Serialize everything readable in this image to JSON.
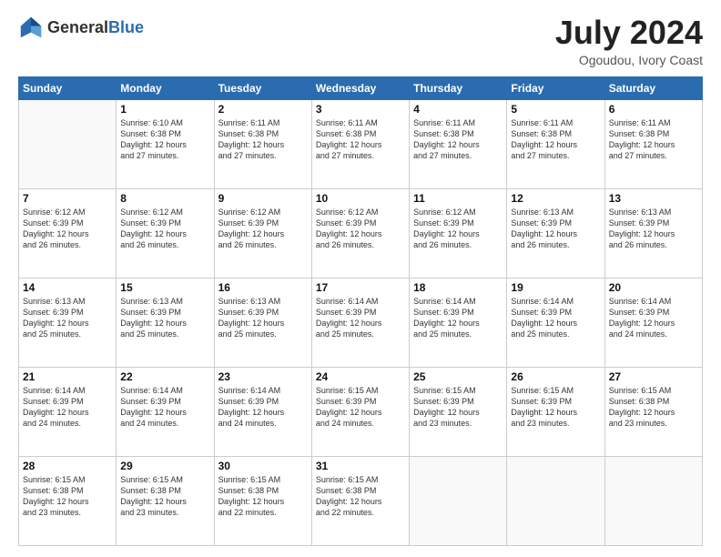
{
  "header": {
    "logo_general": "General",
    "logo_blue": "Blue",
    "month_title": "July 2024",
    "location": "Ogoudou, Ivory Coast"
  },
  "calendar": {
    "days_of_week": [
      "Sunday",
      "Monday",
      "Tuesday",
      "Wednesday",
      "Thursday",
      "Friday",
      "Saturday"
    ],
    "weeks": [
      [
        {
          "day": "",
          "info": ""
        },
        {
          "day": "1",
          "info": "Sunrise: 6:10 AM\nSunset: 6:38 PM\nDaylight: 12 hours\nand 27 minutes."
        },
        {
          "day": "2",
          "info": "Sunrise: 6:11 AM\nSunset: 6:38 PM\nDaylight: 12 hours\nand 27 minutes."
        },
        {
          "day": "3",
          "info": "Sunrise: 6:11 AM\nSunset: 6:38 PM\nDaylight: 12 hours\nand 27 minutes."
        },
        {
          "day": "4",
          "info": "Sunrise: 6:11 AM\nSunset: 6:38 PM\nDaylight: 12 hours\nand 27 minutes."
        },
        {
          "day": "5",
          "info": "Sunrise: 6:11 AM\nSunset: 6:38 PM\nDaylight: 12 hours\nand 27 minutes."
        },
        {
          "day": "6",
          "info": "Sunrise: 6:11 AM\nSunset: 6:38 PM\nDaylight: 12 hours\nand 27 minutes."
        }
      ],
      [
        {
          "day": "7",
          "info": "Sunrise: 6:12 AM\nSunset: 6:39 PM\nDaylight: 12 hours\nand 26 minutes."
        },
        {
          "day": "8",
          "info": "Sunrise: 6:12 AM\nSunset: 6:39 PM\nDaylight: 12 hours\nand 26 minutes."
        },
        {
          "day": "9",
          "info": "Sunrise: 6:12 AM\nSunset: 6:39 PM\nDaylight: 12 hours\nand 26 minutes."
        },
        {
          "day": "10",
          "info": "Sunrise: 6:12 AM\nSunset: 6:39 PM\nDaylight: 12 hours\nand 26 minutes."
        },
        {
          "day": "11",
          "info": "Sunrise: 6:12 AM\nSunset: 6:39 PM\nDaylight: 12 hours\nand 26 minutes."
        },
        {
          "day": "12",
          "info": "Sunrise: 6:13 AM\nSunset: 6:39 PM\nDaylight: 12 hours\nand 26 minutes."
        },
        {
          "day": "13",
          "info": "Sunrise: 6:13 AM\nSunset: 6:39 PM\nDaylight: 12 hours\nand 26 minutes."
        }
      ],
      [
        {
          "day": "14",
          "info": "Sunrise: 6:13 AM\nSunset: 6:39 PM\nDaylight: 12 hours\nand 25 minutes."
        },
        {
          "day": "15",
          "info": "Sunrise: 6:13 AM\nSunset: 6:39 PM\nDaylight: 12 hours\nand 25 minutes."
        },
        {
          "day": "16",
          "info": "Sunrise: 6:13 AM\nSunset: 6:39 PM\nDaylight: 12 hours\nand 25 minutes."
        },
        {
          "day": "17",
          "info": "Sunrise: 6:14 AM\nSunset: 6:39 PM\nDaylight: 12 hours\nand 25 minutes."
        },
        {
          "day": "18",
          "info": "Sunrise: 6:14 AM\nSunset: 6:39 PM\nDaylight: 12 hours\nand 25 minutes."
        },
        {
          "day": "19",
          "info": "Sunrise: 6:14 AM\nSunset: 6:39 PM\nDaylight: 12 hours\nand 25 minutes."
        },
        {
          "day": "20",
          "info": "Sunrise: 6:14 AM\nSunset: 6:39 PM\nDaylight: 12 hours\nand 24 minutes."
        }
      ],
      [
        {
          "day": "21",
          "info": "Sunrise: 6:14 AM\nSunset: 6:39 PM\nDaylight: 12 hours\nand 24 minutes."
        },
        {
          "day": "22",
          "info": "Sunrise: 6:14 AM\nSunset: 6:39 PM\nDaylight: 12 hours\nand 24 minutes."
        },
        {
          "day": "23",
          "info": "Sunrise: 6:14 AM\nSunset: 6:39 PM\nDaylight: 12 hours\nand 24 minutes."
        },
        {
          "day": "24",
          "info": "Sunrise: 6:15 AM\nSunset: 6:39 PM\nDaylight: 12 hours\nand 24 minutes."
        },
        {
          "day": "25",
          "info": "Sunrise: 6:15 AM\nSunset: 6:39 PM\nDaylight: 12 hours\nand 23 minutes."
        },
        {
          "day": "26",
          "info": "Sunrise: 6:15 AM\nSunset: 6:39 PM\nDaylight: 12 hours\nand 23 minutes."
        },
        {
          "day": "27",
          "info": "Sunrise: 6:15 AM\nSunset: 6:38 PM\nDaylight: 12 hours\nand 23 minutes."
        }
      ],
      [
        {
          "day": "28",
          "info": "Sunrise: 6:15 AM\nSunset: 6:38 PM\nDaylight: 12 hours\nand 23 minutes."
        },
        {
          "day": "29",
          "info": "Sunrise: 6:15 AM\nSunset: 6:38 PM\nDaylight: 12 hours\nand 23 minutes."
        },
        {
          "day": "30",
          "info": "Sunrise: 6:15 AM\nSunset: 6:38 PM\nDaylight: 12 hours\nand 22 minutes."
        },
        {
          "day": "31",
          "info": "Sunrise: 6:15 AM\nSunset: 6:38 PM\nDaylight: 12 hours\nand 22 minutes."
        },
        {
          "day": "",
          "info": ""
        },
        {
          "day": "",
          "info": ""
        },
        {
          "day": "",
          "info": ""
        }
      ]
    ]
  }
}
